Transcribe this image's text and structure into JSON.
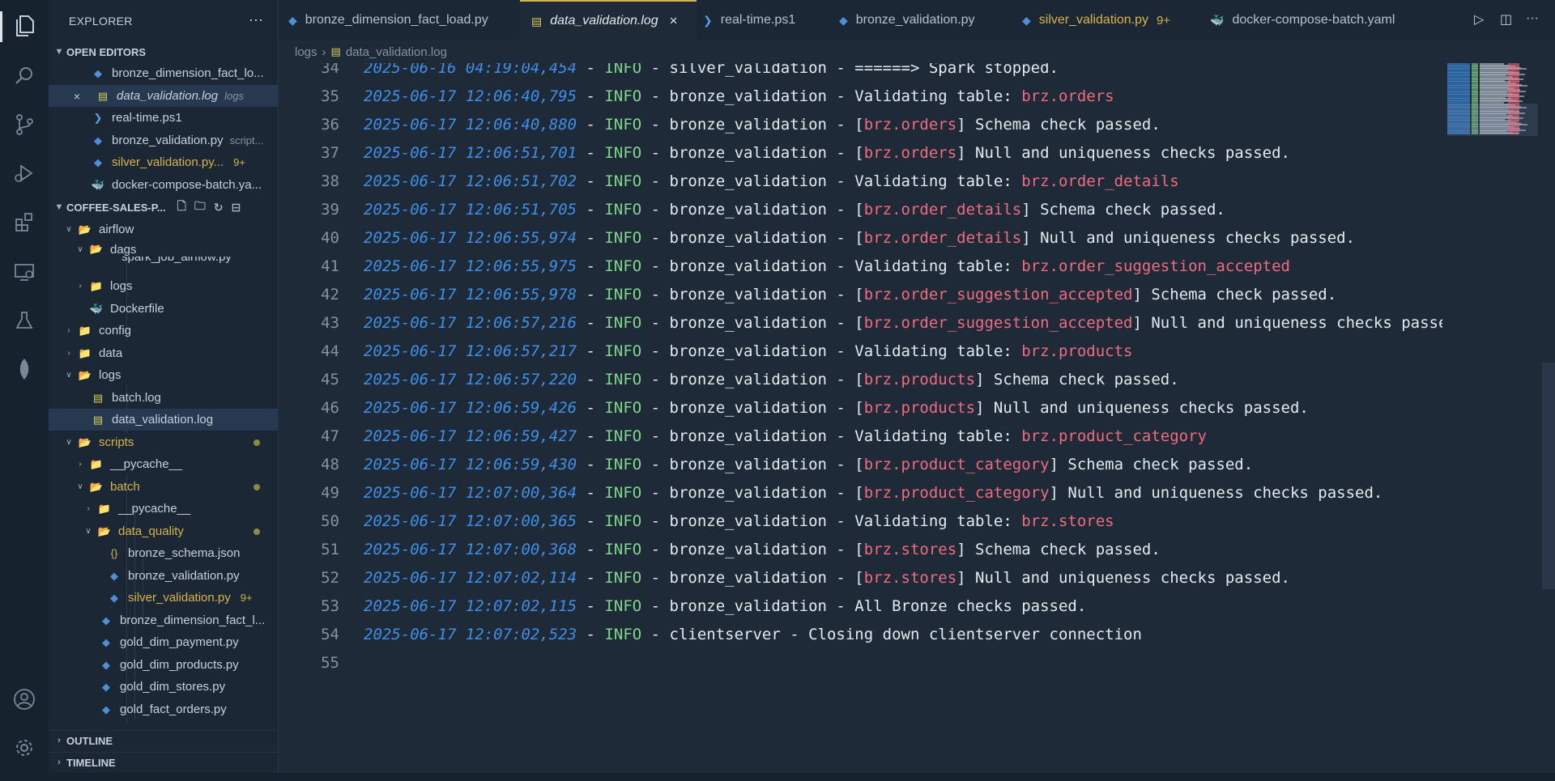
{
  "explorer": {
    "title": "EXPLORER",
    "more": "···",
    "open_editors": {
      "label": "OPEN EDITORS",
      "items": [
        {
          "name": "bronze_dimension_fact_lo...",
          "icon": "python-icon"
        },
        {
          "name": "data_validation.log",
          "desc": "logs",
          "icon": "log-file-icon",
          "close": "×"
        },
        {
          "name": "real-time.ps1",
          "icon": "powershell-icon"
        },
        {
          "name": "bronze_validation.py",
          "desc": "script...",
          "icon": "python-icon"
        },
        {
          "name": "silver_validation.py...",
          "badge": "9+",
          "icon": "python-icon"
        },
        {
          "name": "docker-compose-batch.ya...",
          "icon": "docker-icon"
        }
      ]
    },
    "project": {
      "label": "COFFEE-SALES-P...",
      "tree": [
        {
          "name": "airflow"
        },
        {
          "name": "dags"
        },
        {
          "name": "spark_job_airflow.py"
        },
        {
          "name": "logs"
        },
        {
          "name": "Dockerfile"
        },
        {
          "name": "config"
        },
        {
          "name": "data"
        },
        {
          "name": "logs"
        },
        {
          "name": "batch.log"
        },
        {
          "name": "data_validation.log"
        },
        {
          "name": "scripts"
        },
        {
          "name": "__pycache__"
        },
        {
          "name": "batch"
        },
        {
          "name": "__pycache__"
        },
        {
          "name": "data_quality"
        },
        {
          "name": "bronze_schema.json"
        },
        {
          "name": "bronze_validation.py"
        },
        {
          "name": "silver_validation.py",
          "badge": "9+"
        },
        {
          "name": "bronze_dimension_fact_l..."
        },
        {
          "name": "gold_dim_payment.py"
        },
        {
          "name": "gold_dim_products.py"
        },
        {
          "name": "gold_dim_stores.py"
        },
        {
          "name": "gold_fact_orders.py"
        }
      ]
    },
    "outline_label": "OUTLINE",
    "timeline_label": "TIMELINE"
  },
  "tabs": [
    {
      "label": "bronze_dimension_fact_load.py"
    },
    {
      "label": "data_validation.log",
      "close": "×"
    },
    {
      "label": "real-time.ps1"
    },
    {
      "label": "bronze_validation.py"
    },
    {
      "label": "silver_validation.py",
      "badge": "9+"
    },
    {
      "label": "docker-compose-batch.yaml"
    }
  ],
  "breadcrumb": {
    "folder": "logs",
    "sep": "›",
    "file": "data_validation.log"
  },
  "editor": {
    "lines": [
      {
        "n": "34",
        "ts": "2025-06-16 04:19:04,454",
        "d1": " - ",
        "lvl": "INFO",
        "d2": " - ",
        "pre": "silver_validation - ======> Spark stopped.",
        "tbl": "",
        "post": ""
      },
      {
        "n": "35",
        "ts": "2025-06-17 12:06:40,795",
        "d1": " - ",
        "lvl": "INFO",
        "d2": " - ",
        "pre": "bronze_validation - Validating table: ",
        "tbl": "brz.orders",
        "post": ""
      },
      {
        "n": "36",
        "ts": "2025-06-17 12:06:40,880",
        "d1": " - ",
        "lvl": "INFO",
        "d2": " - ",
        "pre": "bronze_validation - [",
        "tbl": "brz.orders",
        "post": "] Schema check passed."
      },
      {
        "n": "37",
        "ts": "2025-06-17 12:06:51,701",
        "d1": " - ",
        "lvl": "INFO",
        "d2": " - ",
        "pre": "bronze_validation - [",
        "tbl": "brz.orders",
        "post": "] Null and uniqueness checks passed."
      },
      {
        "n": "38",
        "ts": "2025-06-17 12:06:51,702",
        "d1": " - ",
        "lvl": "INFO",
        "d2": " - ",
        "pre": "bronze_validation - Validating table: ",
        "tbl": "brz.order_details",
        "post": ""
      },
      {
        "n": "39",
        "ts": "2025-06-17 12:06:51,705",
        "d1": " - ",
        "lvl": "INFO",
        "d2": " - ",
        "pre": "bronze_validation - [",
        "tbl": "brz.order_details",
        "post": "] Schema check passed."
      },
      {
        "n": "40",
        "ts": "2025-06-17 12:06:55,974",
        "d1": " - ",
        "lvl": "INFO",
        "d2": " - ",
        "pre": "bronze_validation - [",
        "tbl": "brz.order_details",
        "post": "] Null and uniqueness checks passed."
      },
      {
        "n": "41",
        "ts": "2025-06-17 12:06:55,975",
        "d1": " - ",
        "lvl": "INFO",
        "d2": " - ",
        "pre": "bronze_validation - Validating table: ",
        "tbl": "brz.order_suggestion_accepted",
        "post": ""
      },
      {
        "n": "42",
        "ts": "2025-06-17 12:06:55,978",
        "d1": " - ",
        "lvl": "INFO",
        "d2": " - ",
        "pre": "bronze_validation - [",
        "tbl": "brz.order_suggestion_accepted",
        "post": "] Schema check passed."
      },
      {
        "n": "43",
        "ts": "2025-06-17 12:06:57,216",
        "d1": " - ",
        "lvl": "INFO",
        "d2": " - ",
        "pre": "bronze_validation - [",
        "tbl": "brz.order_suggestion_accepted",
        "post": "] Null and uniqueness checks passed."
      },
      {
        "n": "44",
        "ts": "2025-06-17 12:06:57,217",
        "d1": " - ",
        "lvl": "INFO",
        "d2": " - ",
        "pre": "bronze_validation - Validating table: ",
        "tbl": "brz.products",
        "post": ""
      },
      {
        "n": "45",
        "ts": "2025-06-17 12:06:57,220",
        "d1": " - ",
        "lvl": "INFO",
        "d2": " - ",
        "pre": "bronze_validation - [",
        "tbl": "brz.products",
        "post": "] Schema check passed."
      },
      {
        "n": "46",
        "ts": "2025-06-17 12:06:59,426",
        "d1": " - ",
        "lvl": "INFO",
        "d2": " - ",
        "pre": "bronze_validation - [",
        "tbl": "brz.products",
        "post": "] Null and uniqueness checks passed."
      },
      {
        "n": "47",
        "ts": "2025-06-17 12:06:59,427",
        "d1": " - ",
        "lvl": "INFO",
        "d2": " - ",
        "pre": "bronze_validation - Validating table: ",
        "tbl": "brz.product_category",
        "post": ""
      },
      {
        "n": "48",
        "ts": "2025-06-17 12:06:59,430",
        "d1": " - ",
        "lvl": "INFO",
        "d2": " - ",
        "pre": "bronze_validation - [",
        "tbl": "brz.product_category",
        "post": "] Schema check passed."
      },
      {
        "n": "49",
        "ts": "2025-06-17 12:07:00,364",
        "d1": " - ",
        "lvl": "INFO",
        "d2": " - ",
        "pre": "bronze_validation - [",
        "tbl": "brz.product_category",
        "post": "] Null and uniqueness checks passed."
      },
      {
        "n": "50",
        "ts": "2025-06-17 12:07:00,365",
        "d1": " - ",
        "lvl": "INFO",
        "d2": " - ",
        "pre": "bronze_validation - Validating table: ",
        "tbl": "brz.stores",
        "post": ""
      },
      {
        "n": "51",
        "ts": "2025-06-17 12:07:00,368",
        "d1": " - ",
        "lvl": "INFO",
        "d2": " - ",
        "pre": "bronze_validation - [",
        "tbl": "brz.stores",
        "post": "] Schema check passed."
      },
      {
        "n": "52",
        "ts": "2025-06-17 12:07:02,114",
        "d1": " - ",
        "lvl": "INFO",
        "d2": " - ",
        "pre": "bronze_validation - [",
        "tbl": "brz.stores",
        "post": "] Null and uniqueness checks passed."
      },
      {
        "n": "53",
        "ts": "2025-06-17 12:07:02,115",
        "d1": " - ",
        "lvl": "INFO",
        "d2": " - ",
        "pre": "bronze_validation - All Bronze checks passed.",
        "tbl": "",
        "post": ""
      },
      {
        "n": "54",
        "ts": "2025-06-17 12:07:02,523",
        "d1": " - ",
        "lvl": "INFO",
        "d2": " - ",
        "pre": "clientserver - Closing down clientserver connection",
        "tbl": "",
        "post": ""
      },
      {
        "n": "55",
        "ts": "",
        "d1": "",
        "lvl": "",
        "d2": "",
        "pre": "",
        "tbl": "",
        "post": ""
      }
    ]
  },
  "colors": {
    "timestamp": "#3f8fe6",
    "level": "#7fd88a",
    "table": "#f06b7e",
    "modified": "#d9b44a",
    "accent": "#d9b44a"
  }
}
